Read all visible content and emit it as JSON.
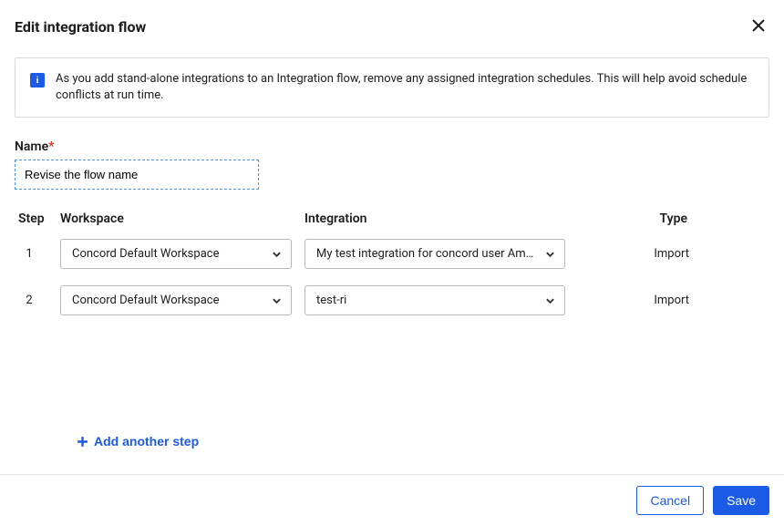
{
  "dialog": {
    "title": "Edit integration flow"
  },
  "banner": {
    "text": "As you add stand-alone integrations to an Integration flow, remove any assigned integration schedules. This will help avoid schedule conflicts at run time."
  },
  "name_field": {
    "label": "Name",
    "value": "Revise the flow name"
  },
  "columns": {
    "step": "Step",
    "workspace": "Workspace",
    "integration": "Integration",
    "type": "Type"
  },
  "steps": [
    {
      "number": "1",
      "workspace": "Concord Default Workspace",
      "integration": "My test integration for concord user Amazon ...",
      "type": "Import"
    },
    {
      "number": "2",
      "workspace": "Concord Default Workspace",
      "integration": "test-ri",
      "type": "Import"
    }
  ],
  "actions": {
    "add_step": "Add another step",
    "cancel": "Cancel",
    "save": "Save"
  }
}
